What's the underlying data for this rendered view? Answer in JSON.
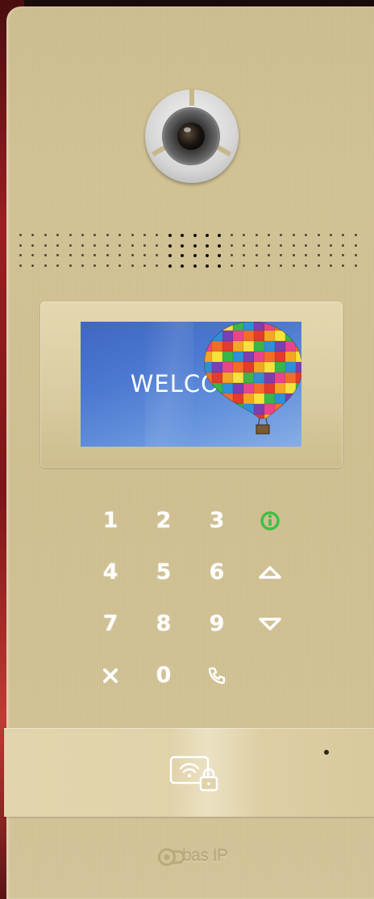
{
  "device": {
    "name": "intercom-panel",
    "finish_color": "#cfbf90"
  },
  "screen": {
    "message": "WELCOME"
  },
  "keypad": {
    "keys": [
      {
        "label": "1",
        "type": "digit"
      },
      {
        "label": "2",
        "type": "digit"
      },
      {
        "label": "3",
        "type": "digit"
      },
      {
        "label": "",
        "type": "info",
        "icon": "info-icon",
        "color": "#3fbf45"
      },
      {
        "label": "4",
        "type": "digit"
      },
      {
        "label": "5",
        "type": "digit"
      },
      {
        "label": "6",
        "type": "digit"
      },
      {
        "label": "",
        "type": "up",
        "icon": "chevron-up-icon"
      },
      {
        "label": "7",
        "type": "digit"
      },
      {
        "label": "8",
        "type": "digit"
      },
      {
        "label": "9",
        "type": "digit"
      },
      {
        "label": "",
        "type": "down",
        "icon": "chevron-down-icon"
      },
      {
        "label": "",
        "type": "cancel",
        "icon": "close-icon"
      },
      {
        "label": "0",
        "type": "digit"
      },
      {
        "label": "",
        "type": "call",
        "icon": "phone-icon"
      }
    ]
  },
  "reader": {
    "icon": "nfc-card-lock-icon"
  },
  "brand": {
    "label": "bas IP"
  }
}
